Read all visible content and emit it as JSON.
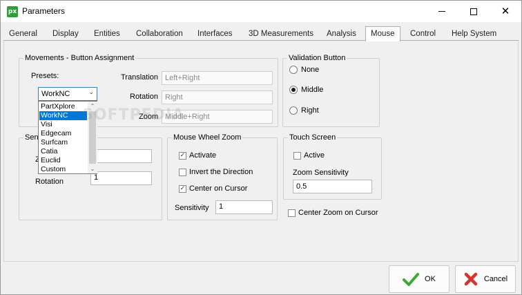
{
  "window": {
    "title": "Parameters",
    "app_icon_text": "px"
  },
  "tabs": [
    {
      "label": "General"
    },
    {
      "label": "Display"
    },
    {
      "label": "Entities"
    },
    {
      "label": "Collaboration"
    },
    {
      "label": "Interfaces"
    },
    {
      "label": "3D Measurements"
    },
    {
      "label": "Analysis"
    },
    {
      "label": "Mouse",
      "active": true
    },
    {
      "label": "Control"
    },
    {
      "label": "Help System"
    }
  ],
  "movements": {
    "legend": "Movements - Button Assignment",
    "presets_label": "Presets:",
    "presets_value": "WorkNC",
    "presets_options": [
      "PartXplore",
      "WorkNC",
      "Visi",
      "Edgecam",
      "Surfcam",
      "Catia",
      "Euclid",
      "Custom"
    ],
    "translation_label": "Translation",
    "translation_value": "Left+Right",
    "rotation_label": "Rotation",
    "rotation_value": "Right",
    "zoom_label": "Zoom",
    "zoom_value": "Middle+Right"
  },
  "validation": {
    "legend": "Validation Button",
    "options": [
      {
        "label": "None",
        "checked": false
      },
      {
        "label": "Middle",
        "checked": true
      },
      {
        "label": "Right",
        "checked": false
      }
    ]
  },
  "sensitivity": {
    "legend_visible": "Sen",
    "zoom_label_visible": "Z",
    "rotation_label": "Rotation",
    "rotation_value": "1"
  },
  "mouse_wheel_zoom": {
    "legend": "Mouse Wheel Zoom",
    "activate_label": "Activate",
    "activate_checked": true,
    "invert_label": "Invert the Direction",
    "invert_checked": false,
    "center_label": "Center on Cursor",
    "center_checked": true,
    "sensitivity_label": "Sensitivity",
    "sensitivity_value": "1"
  },
  "touch_screen": {
    "legend": "Touch Screen",
    "active_label": "Active",
    "active_checked": false,
    "zoom_sensitivity_label": "Zoom Sensitivity",
    "zoom_sensitivity_value": "0.5"
  },
  "center_zoom": {
    "label": "Center Zoom on Cursor",
    "checked": false
  },
  "watermark": "SOFTPEDIA",
  "buttons": {
    "ok_label": "OK",
    "cancel_label": "Cancel"
  },
  "colors": {
    "selection": "#0078d7",
    "ok_check": "#3aa935",
    "cancel_x": "#d6322e"
  }
}
